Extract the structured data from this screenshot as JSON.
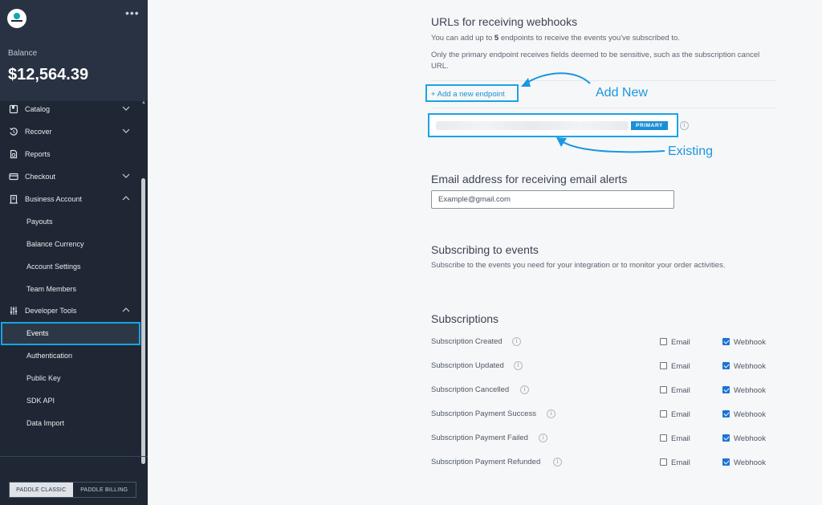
{
  "sidebar": {
    "balance_label": "Balance",
    "balance_value": "$12,564.39",
    "items": [
      {
        "label": "Catalog",
        "icon": "catalog-icon",
        "chevron": "down"
      },
      {
        "label": "Recover",
        "icon": "recover-icon",
        "chevron": "down"
      },
      {
        "label": "Reports",
        "icon": "reports-icon"
      },
      {
        "label": "Checkout",
        "icon": "checkout-icon",
        "chevron": "down"
      },
      {
        "label": "Business Account",
        "icon": "building-icon",
        "chevron": "up"
      },
      {
        "label": "Payouts"
      },
      {
        "label": "Balance Currency"
      },
      {
        "label": "Account Settings"
      },
      {
        "label": "Team Members"
      },
      {
        "label": "Developer Tools",
        "icon": "sliders-icon",
        "chevron": "up"
      },
      {
        "label": "Events",
        "selected": true
      },
      {
        "label": "Authentication"
      },
      {
        "label": "Public Key"
      },
      {
        "label": "SDK API"
      },
      {
        "label": "Data Import"
      }
    ],
    "toggle": {
      "classic": "PADDLE CLASSIC",
      "billing": "PADDLE BILLING"
    }
  },
  "webhooks": {
    "title": "URLs for receiving webhooks",
    "desc_prefix": "You can add up to ",
    "desc_count": "5",
    "desc_suffix": " endpoints to receive the events you've subscribed to.",
    "desc2": "Only the primary endpoint receives fields deemed to be sensitive, such as the subscription cancel URL.",
    "add_link": "+ Add a new endpoint",
    "primary_badge": "PRIMARY"
  },
  "annotations": {
    "add_new": "Add New",
    "existing": "Existing",
    "color": "#1a97e0"
  },
  "email_alerts": {
    "title": "Email address for receiving email alerts",
    "value": "Example@gmail.com"
  },
  "events": {
    "title": "Subscribing to events",
    "desc": "Subscribe to the events you need for your integration or to monitor your order activities."
  },
  "subscriptions": {
    "title": "Subscriptions",
    "email_label": "Email",
    "webhook_label": "Webhook",
    "rows": [
      {
        "label": "Subscription Created",
        "email": false,
        "webhook": true
      },
      {
        "label": "Subscription Updated",
        "email": false,
        "webhook": true
      },
      {
        "label": "Subscription Cancelled",
        "email": false,
        "webhook": true
      },
      {
        "label": "Subscription Payment Success",
        "email": false,
        "webhook": true
      },
      {
        "label": "Subscription Payment Failed",
        "email": false,
        "webhook": true
      },
      {
        "label": "Subscription Payment Refunded",
        "email": false,
        "webhook": true
      }
    ]
  },
  "colors": {
    "sidebar_bg": "#1e2733",
    "accent": "#1aa3e8",
    "link": "#1a8fd6",
    "checkbox": "#1a73d9"
  }
}
